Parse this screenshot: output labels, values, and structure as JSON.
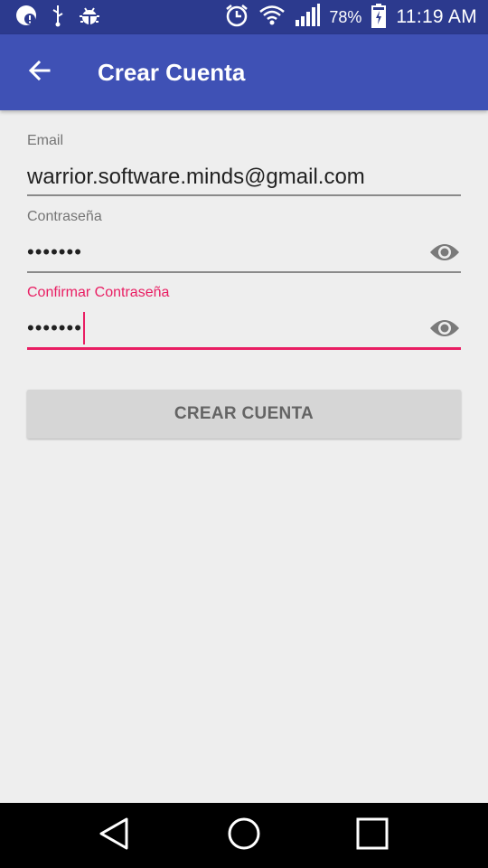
{
  "status_bar": {
    "battery_percent": "78%",
    "time": "11:19 AM",
    "icons": [
      "notification-icon",
      "usb-icon",
      "android-debug-icon",
      "alarm-icon",
      "wifi-icon",
      "signal-icon",
      "battery-charging-icon"
    ]
  },
  "app_bar": {
    "title": "Crear Cuenta",
    "back_icon": "arrow-back-icon",
    "color": "#3f51b5"
  },
  "form": {
    "email": {
      "label": "Email",
      "value": "warrior.software.minds@gmail.com"
    },
    "password": {
      "label": "Contraseña",
      "masked_value": "•••••••",
      "toggle_icon": "eye-icon"
    },
    "confirm_password": {
      "label": "Confirmar Contraseña",
      "masked_value": "•••••••",
      "toggle_icon": "eye-icon",
      "focused": true
    },
    "accent_color": "#e91e63"
  },
  "submit": {
    "label": "CREAR CUENTA"
  },
  "nav_bar": {
    "icons": [
      "back-triangle-icon",
      "home-circle-icon",
      "recents-square-icon"
    ]
  }
}
